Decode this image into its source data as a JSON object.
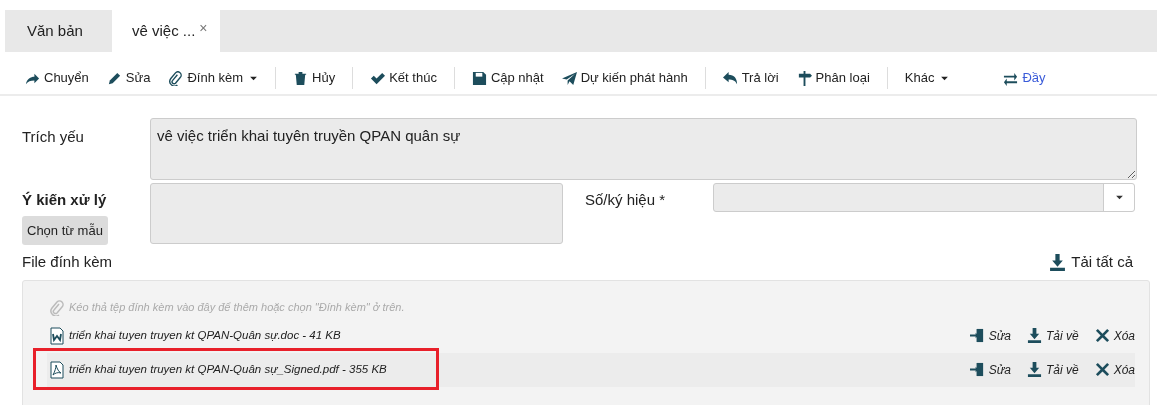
{
  "tabs": [
    {
      "label": "Văn bản",
      "selected": false,
      "closable": false
    },
    {
      "label": "vê việc ...",
      "selected": true,
      "closable": true,
      "close": "×"
    }
  ],
  "toolbar": {
    "groups": [
      [
        {
          "label": "Chuyển",
          "dropdown": false,
          "kind": "button"
        },
        {
          "label": "Sửa",
          "dropdown": false,
          "kind": "button"
        },
        {
          "label": "Đính kèm",
          "dropdown": true,
          "kind": "button"
        }
      ],
      [
        {
          "label": "Hủy",
          "dropdown": false,
          "kind": "button"
        }
      ],
      [
        {
          "label": "Kết thúc",
          "dropdown": false,
          "kind": "button"
        }
      ],
      [
        {
          "label": "Cập nhật",
          "dropdown": false,
          "kind": "button"
        },
        {
          "label": "Dự kiến phát hành",
          "dropdown": false,
          "kind": "button"
        }
      ],
      [
        {
          "label": "Trả lời",
          "dropdown": false,
          "kind": "button"
        },
        {
          "label": "Phân loại",
          "dropdown": false,
          "kind": "button"
        }
      ],
      [
        {
          "label": "Khác",
          "dropdown": true,
          "kind": "button"
        },
        {
          "label": "Đầy",
          "dropdown": false,
          "kind": "link"
        }
      ]
    ]
  },
  "form": {
    "summary": {
      "label": "Trích yếu",
      "value": "vê việc triển khai tuyên truyền QPAN quân sự"
    },
    "opinion": {
      "label": "Ý kiến xử lý",
      "template_button": "Chọn từ mẫu"
    },
    "number": {
      "label": "Số/ký hiệu *"
    }
  },
  "attachments": {
    "label": "File đính kèm",
    "download_all": "Tải tất cả",
    "hint": "Kéo thả tệp đính kèm vào đây để thêm hoặc chọn \"Đính kèm\" ở trên.",
    "files": [
      {
        "name": "triển khai tuyen truyen kt QPAN-Quân sự.doc - 41 KB",
        "kind": "word",
        "highlighted": false,
        "actions": [
          "Sửa",
          "Tải về",
          "Xóa"
        ]
      },
      {
        "name": "triển khai tuyen truyen kt QPAN-Quân sự_Signed.pdf - 355 KB",
        "kind": "pdf",
        "highlighted": true,
        "actions": [
          "Sửa",
          "Tải về",
          "Xóa"
        ]
      }
    ]
  }
}
